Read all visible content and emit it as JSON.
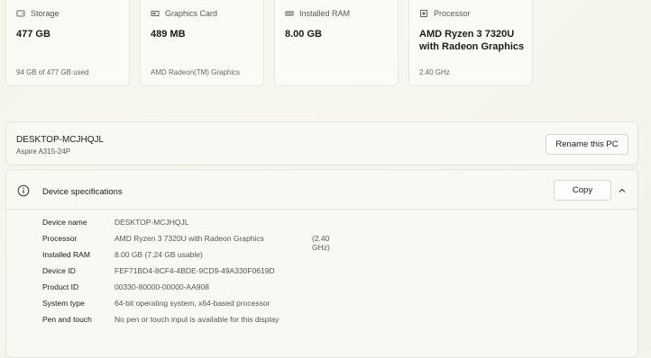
{
  "cards": [
    {
      "icon": "storage-icon",
      "title": "Storage",
      "value": "477 GB",
      "sub": "94 GB of 477 GB used"
    },
    {
      "icon": "graphics-card-icon",
      "title": "Graphics Card",
      "value": "489 MB",
      "sub": "AMD Radeon(TM) Graphics"
    },
    {
      "icon": "ram-icon",
      "title": "Installed RAM",
      "value": "8.00 GB",
      "sub": ""
    },
    {
      "icon": "processor-icon",
      "title": "Processor",
      "value": "AMD Ryzen 3 7320U with Radeon Graphics",
      "sub": "2.40 GHz"
    }
  ],
  "pc": {
    "name": "DESKTOP-MCJHQJL",
    "model": "Aspire A315-24P",
    "rename_label": "Rename this PC"
  },
  "specs": {
    "title": "Device specifications",
    "copy_label": "Copy",
    "rows": [
      {
        "label": "Device name",
        "value": "DESKTOP-MCJHQJL",
        "extra": ""
      },
      {
        "label": "Processor",
        "value": "AMD Ryzen 3 7320U with Radeon Graphics",
        "extra": "(2.40 GHz)"
      },
      {
        "label": "Installed RAM",
        "value": "8.00 GB (7.24 GB usable)",
        "extra": ""
      },
      {
        "label": "Device ID",
        "value": "FEF71BD4-8CF4-4BDE-9CD9-49A330F0619D",
        "extra": ""
      },
      {
        "label": "Product ID",
        "value": "00330-80000-00000-AA908",
        "extra": ""
      },
      {
        "label": "System type",
        "value": "64-bit operating system, x64-based processor",
        "extra": ""
      },
      {
        "label": "Pen and touch",
        "value": "No pen or touch input is available for this display",
        "extra": ""
      }
    ]
  }
}
